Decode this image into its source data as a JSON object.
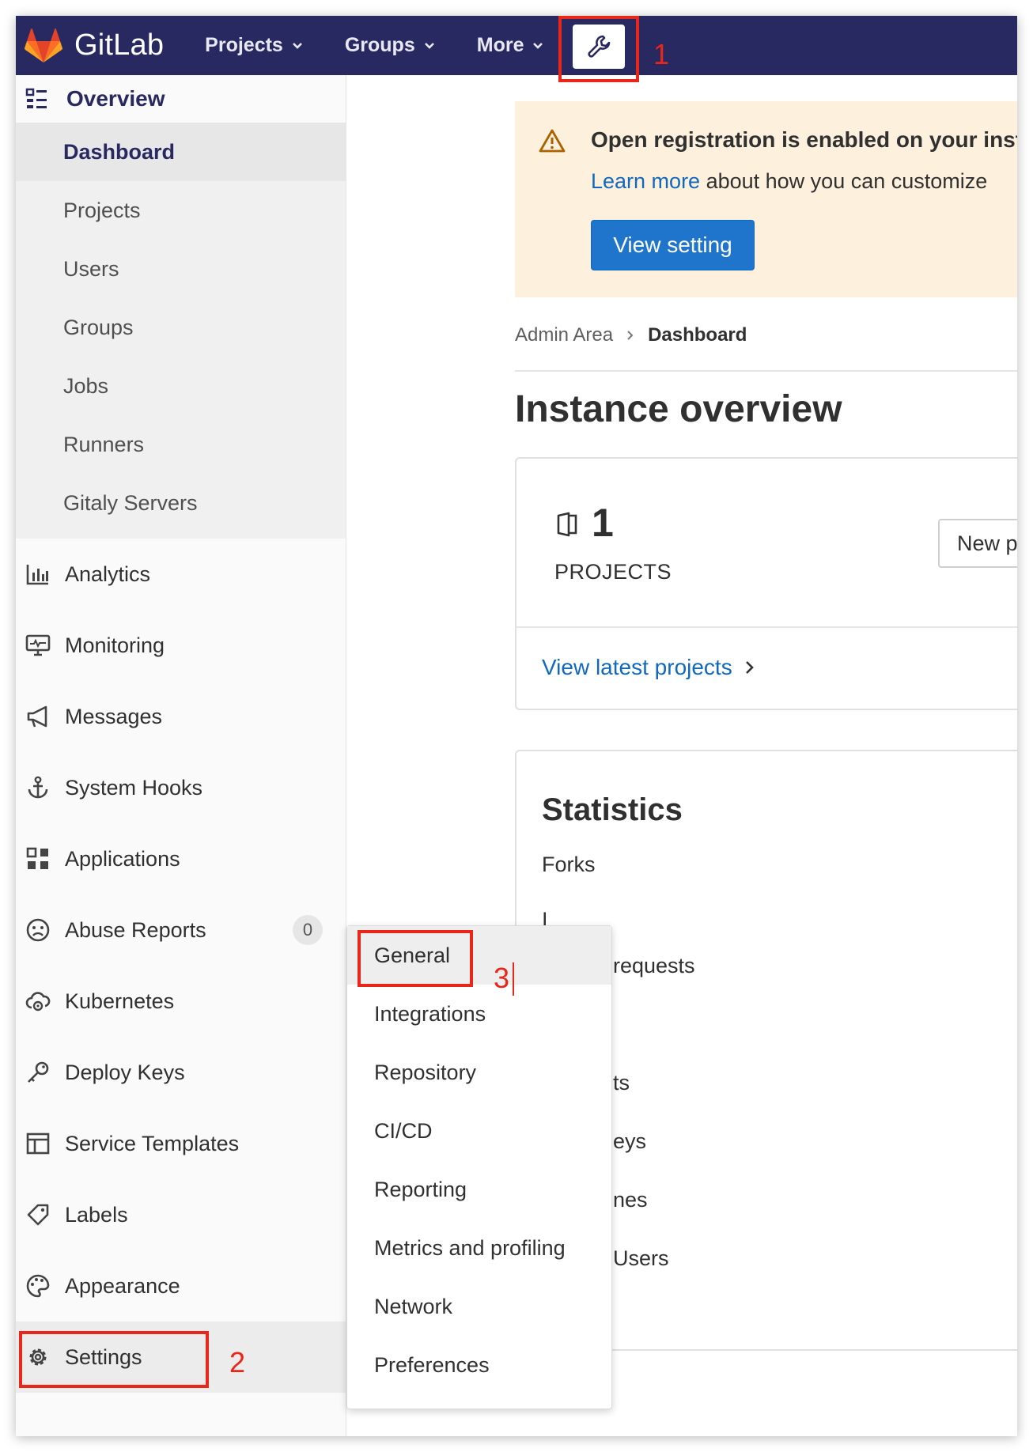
{
  "topnav": {
    "brand": "GitLab",
    "items": [
      {
        "label": "Projects"
      },
      {
        "label": "Groups"
      },
      {
        "label": "More"
      }
    ],
    "admin_icon": "wrench-icon",
    "brand_color": "#292961"
  },
  "annotations": [
    "1",
    "2",
    "3"
  ],
  "sidebar": {
    "section_title": "Overview",
    "sub_items": [
      {
        "label": "Dashboard"
      },
      {
        "label": "Projects"
      },
      {
        "label": "Users"
      },
      {
        "label": "Groups"
      },
      {
        "label": "Jobs"
      },
      {
        "label": "Runners"
      },
      {
        "label": "Gitaly Servers"
      }
    ],
    "items": [
      {
        "label": "Analytics",
        "icon": "chart-icon"
      },
      {
        "label": "Monitoring",
        "icon": "monitor-icon"
      },
      {
        "label": "Messages",
        "icon": "megaphone-icon"
      },
      {
        "label": "System Hooks",
        "icon": "anchor-icon"
      },
      {
        "label": "Applications",
        "icon": "apps-grid-icon"
      },
      {
        "label": "Abuse Reports",
        "icon": "sad-face-icon",
        "badge": "0"
      },
      {
        "label": "Kubernetes",
        "icon": "cloud-gear-icon"
      },
      {
        "label": "Deploy Keys",
        "icon": "key-icon"
      },
      {
        "label": "Service Templates",
        "icon": "template-icon"
      },
      {
        "label": "Labels",
        "icon": "label-tag-icon"
      },
      {
        "label": "Appearance",
        "icon": "palette-icon"
      },
      {
        "label": "Settings",
        "icon": "gear-icon"
      }
    ]
  },
  "alert": {
    "title": "Open registration is enabled on your inst",
    "link": "Learn more",
    "text": " about how you can customize",
    "button": "View setting"
  },
  "breadcrumb": {
    "parent": "Admin Area",
    "current": "Dashboard"
  },
  "page_title": "Instance overview",
  "projects_card": {
    "count": "1",
    "label": "PROJECTS",
    "new_button": "New p",
    "latest_link": "View latest projects"
  },
  "statistics": {
    "title": "Statistics",
    "rows": [
      "Forks",
      "I",
      "requests",
      "ts",
      "eys",
      "nes",
      "Users"
    ]
  },
  "flyout": {
    "items": [
      {
        "label": "General"
      },
      {
        "label": "Integrations"
      },
      {
        "label": "Repository"
      },
      {
        "label": "CI/CD"
      },
      {
        "label": "Reporting"
      },
      {
        "label": "Metrics and profiling"
      },
      {
        "label": "Network"
      },
      {
        "label": "Preferences"
      }
    ]
  },
  "colors": {
    "link": "#1068bf",
    "primary_button": "#1f75cb",
    "alert_background": "#fdf1dd",
    "annotation_red": "#e8261a"
  }
}
